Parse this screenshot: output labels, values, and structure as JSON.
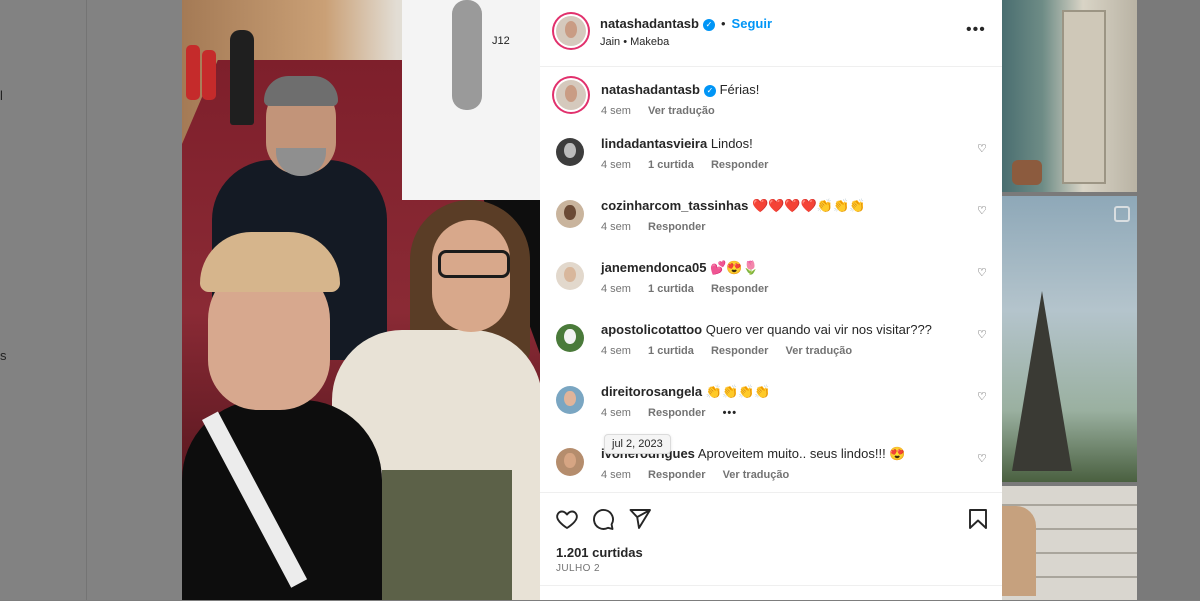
{
  "background": {
    "left_fragments": [
      "l",
      "s"
    ]
  },
  "post": {
    "author": "natashadantasb",
    "follow_label": "Seguir",
    "music": "Jain • Makeba",
    "more_label": "•••",
    "caption": {
      "username": "natashadantasb",
      "text": "Férias!",
      "time": "4 sem",
      "translate": "Ver tradução"
    },
    "comments": [
      {
        "username": "lindadantasvieira",
        "text": "Lindos!",
        "time": "4 sem",
        "likes": "1 curtida",
        "reply": "Responder",
        "translate": ""
      },
      {
        "username": "cozinharcom_tassinhas",
        "text": "❤️❤️❤️❤️👏👏👏",
        "time": "4 sem",
        "likes": "",
        "reply": "Responder",
        "translate": ""
      },
      {
        "username": "janemendonca05",
        "text": "💕😍🌷",
        "time": "4 sem",
        "likes": "1 curtida",
        "reply": "Responder",
        "translate": ""
      },
      {
        "username": "apostolicotattoo",
        "text": "Quero ver quando vai vir nos visitar???",
        "time": "4 sem",
        "likes": "1 curtida",
        "reply": "Responder",
        "translate": "Ver tradução"
      },
      {
        "username": "direitorosangela",
        "text": "👏👏👏👏",
        "time": "4 sem",
        "likes": "",
        "reply": "Responder",
        "translate": "",
        "more": "•••"
      },
      {
        "username": "ivonerodrigues",
        "text": "Aproveitem muito.. seus lindos!!! 😍",
        "time": "4 sem",
        "likes": "",
        "reply": "Responder",
        "translate": "Ver tradução"
      }
    ],
    "tooltip": "jul 2, 2023",
    "like_count": "1.201 curtidas",
    "date": "JULHO 2",
    "photo_ad_text": "J12"
  },
  "colors": {
    "accent": "#0095f6",
    "text": "#262626",
    "muted": "#737373",
    "overlay": "#7d7d7d"
  },
  "icons": [
    "heart-icon",
    "comment-icon",
    "share-icon",
    "bookmark-icon",
    "verified-icon",
    "more-icon"
  ]
}
